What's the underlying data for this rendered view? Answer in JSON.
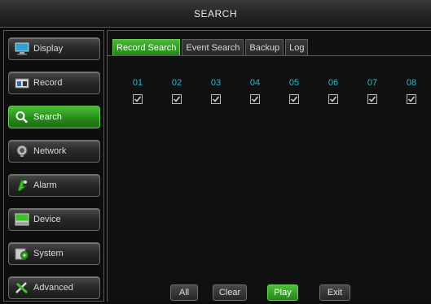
{
  "window": {
    "title": "SEARCH"
  },
  "sidebar": {
    "items": [
      {
        "label": "Display",
        "icon": "monitor-icon"
      },
      {
        "label": "Record",
        "icon": "record-icon"
      },
      {
        "label": "Search",
        "icon": "search-icon",
        "active": true
      },
      {
        "label": "Network",
        "icon": "network-icon"
      },
      {
        "label": "Alarm",
        "icon": "alarm-icon"
      },
      {
        "label": "Device",
        "icon": "device-icon"
      },
      {
        "label": "System",
        "icon": "system-icon"
      },
      {
        "label": "Advanced",
        "icon": "advanced-tools-icon"
      }
    ]
  },
  "tabs": [
    {
      "label": "Record Search",
      "active": true
    },
    {
      "label": "Event Search"
    },
    {
      "label": "Backup"
    },
    {
      "label": "Log"
    }
  ],
  "channels": [
    {
      "number": "01",
      "checked": true
    },
    {
      "number": "02",
      "checked": true
    },
    {
      "number": "03",
      "checked": true
    },
    {
      "number": "04",
      "checked": true
    },
    {
      "number": "05",
      "checked": true
    },
    {
      "number": "06",
      "checked": true
    },
    {
      "number": "07",
      "checked": true
    },
    {
      "number": "08",
      "checked": true
    }
  ],
  "buttons": {
    "all": "All",
    "clear": "Clear",
    "play": "Play",
    "exit": "Exit"
  },
  "colors": {
    "accent": "#27901a",
    "channel_number": "#2bb7c9"
  }
}
